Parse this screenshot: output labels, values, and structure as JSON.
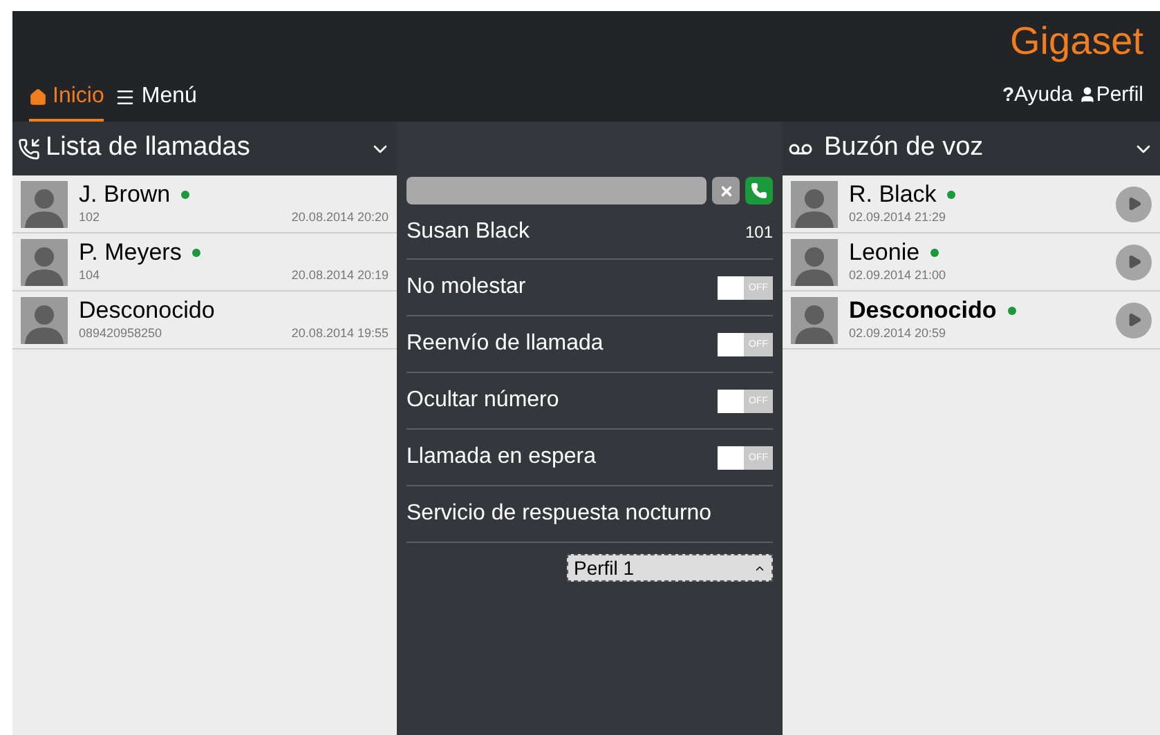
{
  "brand": "Gigaset",
  "nav": [
    {
      "label": "Inicio",
      "selected": true
    },
    {
      "label": "Menú",
      "selected": false
    }
  ],
  "nav_right": [
    {
      "glyph": "?",
      "label": "Ayuda"
    },
    {
      "label": "Perfil"
    }
  ],
  "calls": {
    "title": "Lista de llamadas",
    "items": [
      {
        "name": "J. Brown",
        "online": true,
        "number": "102",
        "time": "20.08.2014 20:20"
      },
      {
        "name": "P. Meyers",
        "online": true,
        "number": "104",
        "time": "20.08.2014 20:19"
      },
      {
        "name": "Desconocido",
        "online": false,
        "number": "089420958250",
        "time": "20.08.2014 19:55"
      }
    ]
  },
  "center": {
    "user": {
      "name": "Susan Black",
      "extension": "101"
    },
    "settings": [
      {
        "kind": "toggle",
        "label": "No molestar",
        "on": false,
        "state_text": "OFF"
      },
      {
        "kind": "toggle",
        "label": "Reenvío de llamada",
        "on": false,
        "state_text": "OFF"
      },
      {
        "kind": "toggle",
        "label": "Ocultar número",
        "on": false,
        "state_text": "OFF"
      },
      {
        "kind": "toggle",
        "label": "Llamada en espera",
        "on": false,
        "state_text": "OFF"
      },
      {
        "kind": "label",
        "label": "Servicio de respuesta nocturno"
      }
    ],
    "profile_select": {
      "value": "Perfil 1"
    }
  },
  "voicemail": {
    "title": "Buzón de voz",
    "items": [
      {
        "name": "R. Black",
        "online": true,
        "unread": false,
        "time": "02.09.2014 21:29"
      },
      {
        "name": "Leonie",
        "online": true,
        "unread": false,
        "time": "02.09.2014 21:00"
      },
      {
        "name": "Desconocido",
        "online": true,
        "unread": true,
        "time": "02.09.2014 20:59"
      }
    ]
  }
}
